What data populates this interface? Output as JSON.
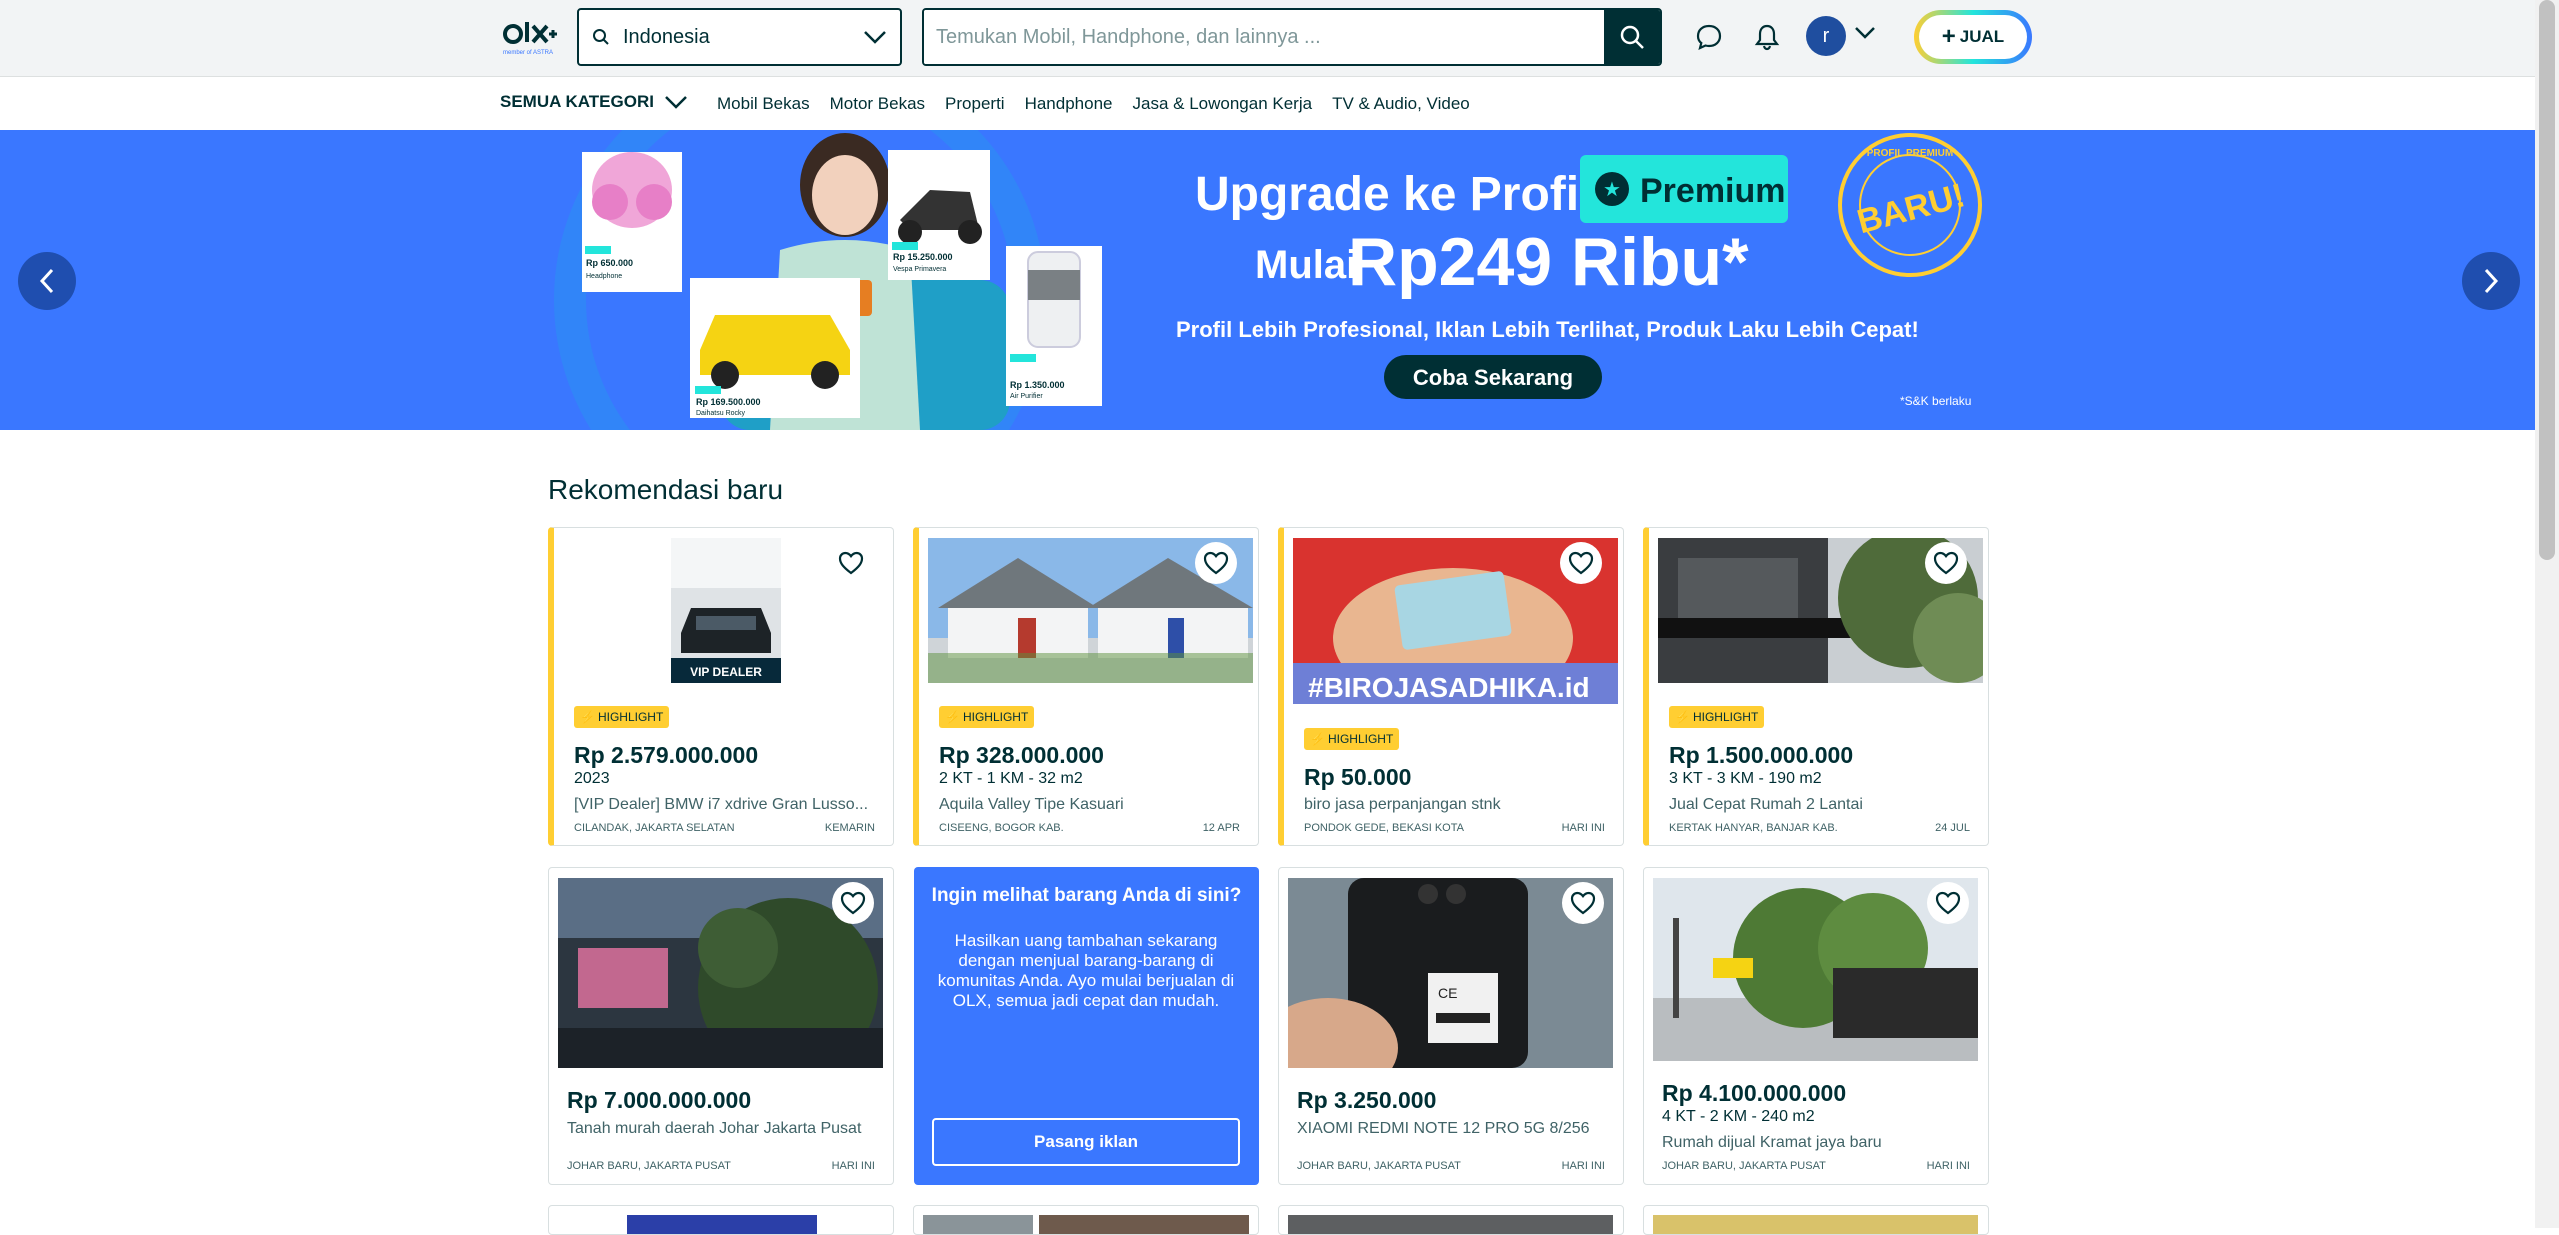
{
  "header": {
    "logo_text": "OLX",
    "logo_sub": "member of ASTRA",
    "location_value": "Indonesia",
    "search_placeholder": "Temukan Mobil, Handphone, dan lainnya ...",
    "avatar_initial": "r",
    "sell_label": "JUAL"
  },
  "categories": {
    "all_label": "SEMUA KATEGORI",
    "links": [
      "Mobil Bekas",
      "Motor Bekas",
      "Properti",
      "Handphone",
      "Jasa & Lowongan Kerja",
      "TV & Audio, Video"
    ]
  },
  "banner": {
    "headline1": "Upgrade ke Profil",
    "premium_label": "Premium",
    "headline2": "Mulai",
    "price_text": "Rp249 Ribu*",
    "tagline": "Profil Lebih Profesional, Iklan Lebih Terlihat, Produk Laku Lebih Cepat!",
    "cta": "Coba Sekarang",
    "seal_text": "BARU!",
    "seal_ring": "PROFIL PREMIUM",
    "note": "*S&K berlaku",
    "slide_count": 7,
    "active_slide": 1,
    "product_tags": [
      {
        "price": "Rp 650.000",
        "name": "Headphone"
      },
      {
        "price": "Rp 169.500.000",
        "name": "Daihatsu Rocky"
      },
      {
        "price": "Rp 15.250.000",
        "name": "Vespa Primavera"
      },
      {
        "price": "Rp 1.350.000",
        "name": "Air Purifier"
      }
    ],
    "premium_tag": "Premium",
    "colors": {
      "bg": "#3a77ff",
      "accent": "#23e5db",
      "dark": "#002f34",
      "seal": "#ffce32"
    }
  },
  "section_title": "Rekomendasi baru",
  "listings": [
    {
      "highlight": "HIGHLIGHT",
      "price": "Rp 2.579.000.000",
      "sub": "2023",
      "title": "[VIP Dealer] BMW i7 xdrive Gran Lusso...",
      "location": "CILANDAK, JAKARTA SELATAN",
      "date": "KEMARIN",
      "image_label": "VIP DEALER"
    },
    {
      "highlight": "HIGHLIGHT",
      "price": "Rp 328.000.000",
      "sub": "2 KT - 1 KM - 32 m2",
      "title": "Aquila Valley Tipe Kasuari",
      "location": "CISEENG, BOGOR KAB.",
      "date": "12 APR"
    },
    {
      "highlight": "HIGHLIGHT",
      "price": "Rp 50.000",
      "sub": "",
      "title": "biro jasa perpanjangan stnk",
      "location": "PONDOK GEDE, BEKASI KOTA",
      "date": "HARI INI",
      "image_label": "#BIROJASADHIKA.id"
    },
    {
      "highlight": "HIGHLIGHT",
      "price": "Rp 1.500.000.000",
      "sub": "3 KT - 3 KM - 190 m2",
      "title": "Jual Cepat Rumah 2 Lantai",
      "location": "KERTAK HANYAR, BANJAR KAB.",
      "date": "24 JUL"
    },
    {
      "highlight": "",
      "price": "Rp 7.000.000.000",
      "sub": "",
      "title": "Tanah murah daerah Johar Jakarta Pusat",
      "location": "JOHAR BARU, JAKARTA PUSAT",
      "date": "HARI INI"
    },
    {
      "highlight": "",
      "price": "Rp 3.250.000",
      "sub": "",
      "title": "XIAOMI REDMI NOTE 12 PRO 5G 8/256",
      "location": "JOHAR BARU, JAKARTA PUSAT",
      "date": "HARI INI"
    },
    {
      "highlight": "",
      "price": "Rp 4.100.000.000",
      "sub": "4 KT - 2 KM - 240 m2",
      "title": "Rumah dijual Kramat jaya baru",
      "location": "JOHAR BARU, JAKARTA PUSAT",
      "date": "HARI INI"
    }
  ],
  "promo": {
    "title": "Ingin melihat barang Anda di sini?",
    "body": "Hasilkan uang tambahan sekarang dengan menjual barang-barang di komunitas Anda. Ayo mulai berjualan di OLX, semua jadi cepat dan mudah.",
    "button": "Pasang iklan"
  }
}
